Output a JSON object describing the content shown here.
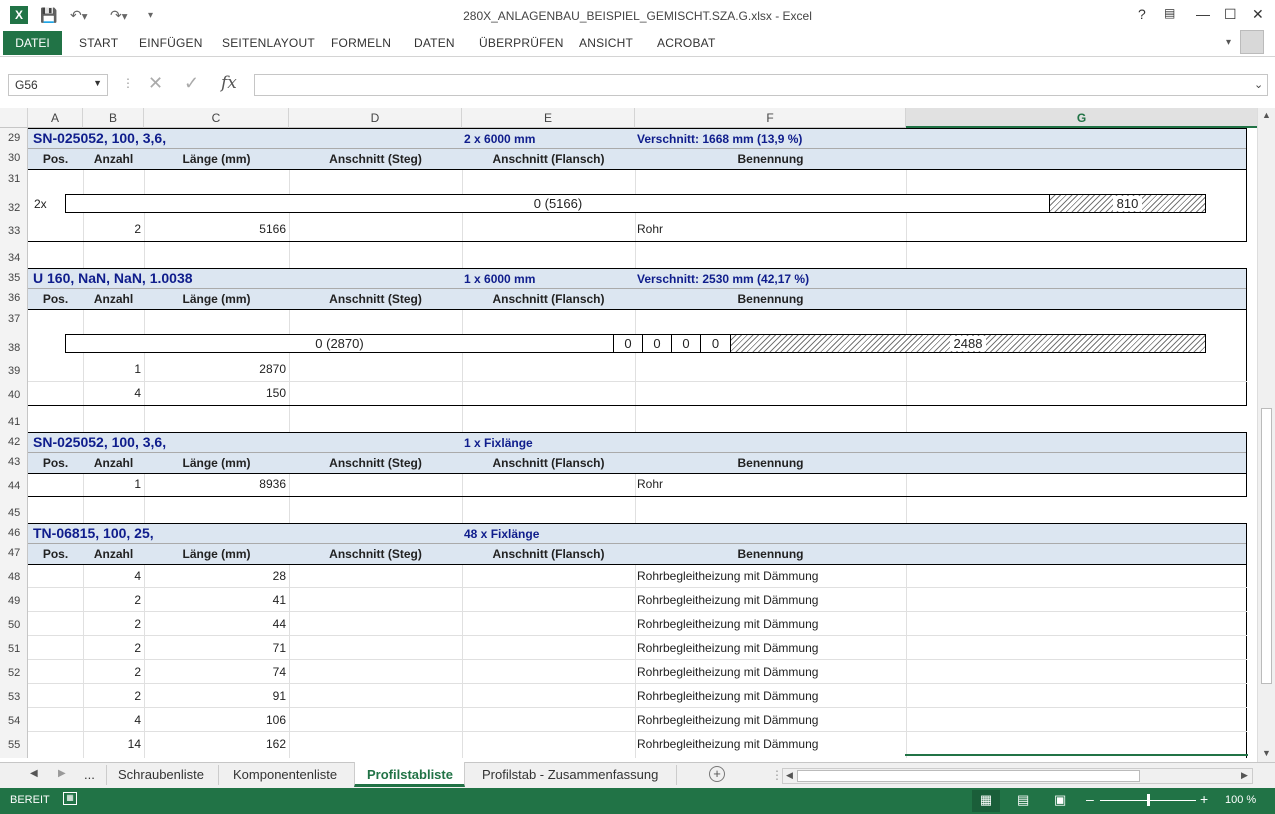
{
  "window": {
    "title": "280X_ANLAGENBAU_BEISPIEL_GEMISCHT.SZA.G.xlsx - Excel"
  },
  "ribbon": {
    "tabs": [
      "DATEI",
      "START",
      "EINFÜGEN",
      "SEITENLAYOUT",
      "FORMELN",
      "DATEN",
      "ÜBERPRÜFEN",
      "ANSICHT",
      "ACROBAT"
    ]
  },
  "formula_bar": {
    "name_box": "G56",
    "fx": "fx",
    "content": ""
  },
  "columns": [
    "A",
    "B",
    "C",
    "D",
    "E",
    "F",
    "G"
  ],
  "rows": [
    "29",
    "30",
    "31",
    "32",
    "33",
    "34",
    "35",
    "36",
    "37",
    "38",
    "39",
    "40",
    "41",
    "42",
    "43",
    "44",
    "45",
    "46",
    "47",
    "48",
    "49",
    "50",
    "51",
    "52",
    "53",
    "54",
    "55"
  ],
  "headers": {
    "pos": "Pos.",
    "anzahl": "Anzahl",
    "laenge": "Länge (mm)",
    "steg": "Anschnitt (Steg)",
    "flansch": "Anschnitt (Flansch)",
    "benennung": "Benennung"
  },
  "blocks": [
    {
      "title": "SN-025052, 100, 3,6,",
      "qty": "2 x 6000 mm",
      "waste": "Verschnitt: 1668 mm (13,9 %)",
      "bar_mult": "2x",
      "bar_main": "0 (5166)",
      "bar_rest": "810",
      "rows": [
        {
          "anzahl": "2",
          "laenge": "5166",
          "benennung": "Rohr"
        }
      ]
    },
    {
      "title": "U 160, NaN, NaN, 1.0038",
      "qty": "1 x 6000 mm",
      "waste": "Verschnitt: 2530 mm (42,17 %)",
      "bar_main": "0 (2870)",
      "bar_small": [
        "0",
        "0",
        "0",
        "0"
      ],
      "bar_rest": "2488",
      "rows": [
        {
          "anzahl": "1",
          "laenge": "2870",
          "benennung": ""
        },
        {
          "anzahl": "4",
          "laenge": "150",
          "benennung": ""
        }
      ]
    },
    {
      "title": "SN-025052, 100, 3,6,",
      "qty": "1 x Fixlänge",
      "rows": [
        {
          "anzahl": "1",
          "laenge": "8936",
          "benennung": "Rohr"
        }
      ]
    },
    {
      "title": "TN-06815, 100, 25,",
      "qty": "48 x Fixlänge",
      "rows": [
        {
          "anzahl": "4",
          "laenge": "28",
          "benennung": "Rohrbegleitheizung mit Dämmung"
        },
        {
          "anzahl": "2",
          "laenge": "41",
          "benennung": "Rohrbegleitheizung mit Dämmung"
        },
        {
          "anzahl": "2",
          "laenge": "44",
          "benennung": "Rohrbegleitheizung mit Dämmung"
        },
        {
          "anzahl": "2",
          "laenge": "71",
          "benennung": "Rohrbegleitheizung mit Dämmung"
        },
        {
          "anzahl": "2",
          "laenge": "74",
          "benennung": "Rohrbegleitheizung mit Dämmung"
        },
        {
          "anzahl": "2",
          "laenge": "91",
          "benennung": "Rohrbegleitheizung mit Dämmung"
        },
        {
          "anzahl": "4",
          "laenge": "106",
          "benennung": "Rohrbegleitheizung mit Dämmung"
        },
        {
          "anzahl": "14",
          "laenge": "162",
          "benennung": "Rohrbegleitheizung mit Dämmung"
        }
      ]
    }
  ],
  "sheets": {
    "more": "...",
    "tabs": [
      "Schraubenliste",
      "Komponentenliste",
      "Profilstabliste",
      "Profilstab - Zusammenfassung"
    ],
    "active": "Profilstabliste"
  },
  "status": {
    "mode": "BEREIT",
    "zoom": "100 %",
    "zoom_fraction": 0.5
  },
  "colors": {
    "accent": "#217346",
    "band": "#dce6f1",
    "title": "#0f1d8c"
  }
}
